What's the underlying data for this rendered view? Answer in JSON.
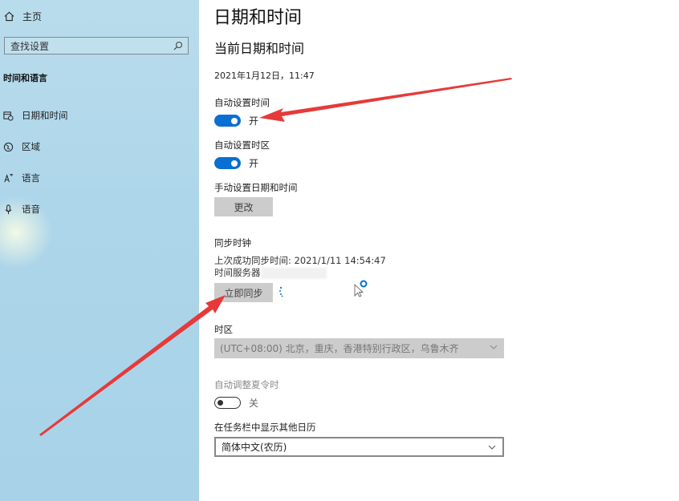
{
  "sidebar": {
    "home_label": "主页",
    "search_placeholder": "查找设置",
    "section_title": "时间和语言",
    "items": [
      {
        "label": "日期和时间",
        "icon": "calendar-clock-icon"
      },
      {
        "label": "区域",
        "icon": "globe-region-icon"
      },
      {
        "label": "语言",
        "icon": "language-icon"
      },
      {
        "label": "语音",
        "icon": "microphone-icon"
      }
    ]
  },
  "main": {
    "page_title": "日期和时间",
    "section_title": "当前日期和时间",
    "current_datetime": "2021年1月12日，11:47",
    "auto_time": {
      "label": "自动设置时间",
      "state": "开"
    },
    "auto_timezone": {
      "label": "自动设置时区",
      "state": "开"
    },
    "manual": {
      "label": "手动设置日期和时间",
      "button": "更改"
    },
    "sync": {
      "label": "同步时钟",
      "last_sync": "上次成功同步时间: 2021/1/11 14:54:47",
      "server_label": "时间服务器",
      "button": "立即同步"
    },
    "timezone": {
      "label": "时区",
      "value": "(UTC+08:00) 北京，重庆，香港特别行政区，乌鲁木齐"
    },
    "dst": {
      "label": "自动调整夏令时",
      "state": "关"
    },
    "calendar": {
      "label": "在任务栏中显示其他日历",
      "value": "简体中文(农历)"
    }
  },
  "colors": {
    "accent": "#0a6fd2",
    "arrow": "#e63a3a",
    "sidebar": "#aed6ea"
  }
}
